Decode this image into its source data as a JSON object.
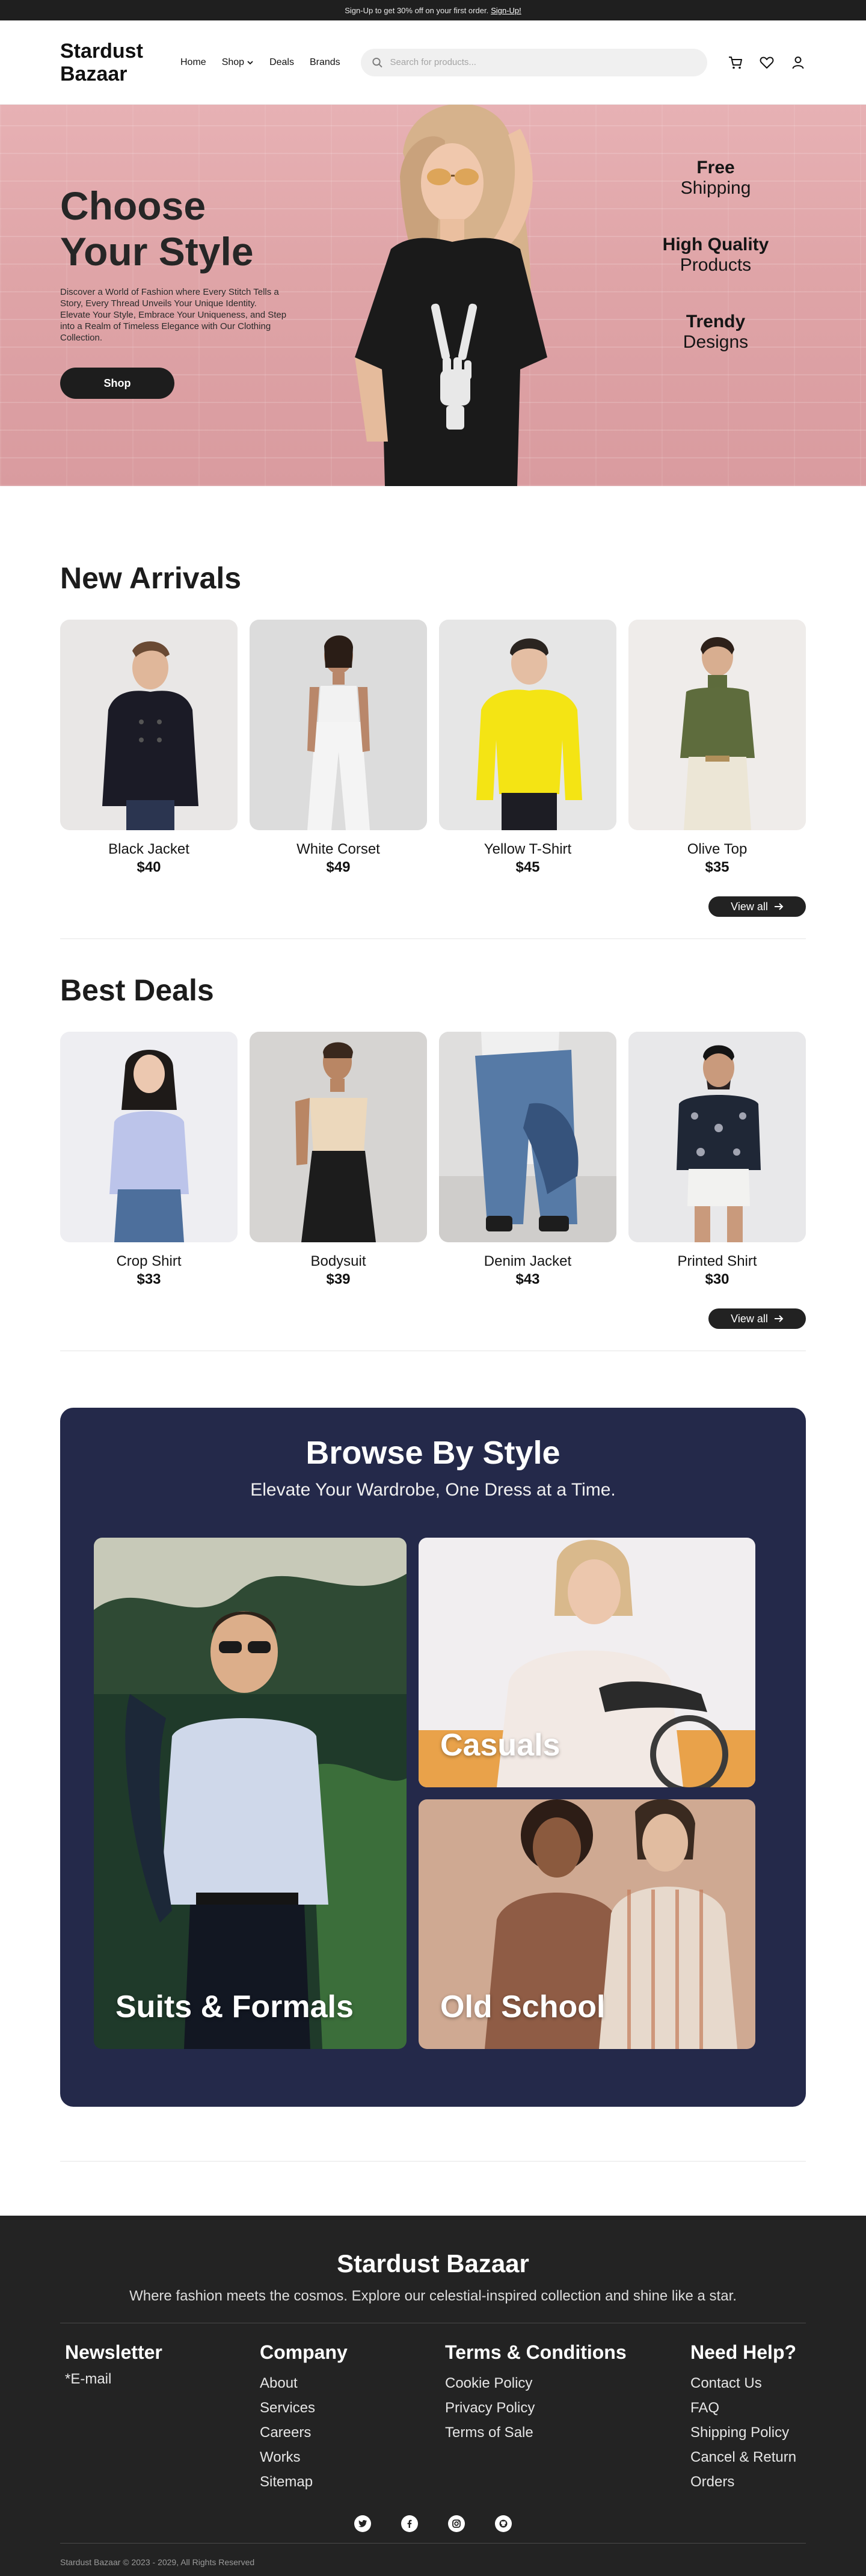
{
  "topbar": {
    "text": "Sign-Up to get 30% off on your first order.",
    "link": "Sign-Up!"
  },
  "header": {
    "logo": "Stardust Bazaar",
    "nav": [
      "Home",
      "Shop",
      "Deals",
      "Brands"
    ],
    "search_placeholder": "Search for products...",
    "icons": [
      "cart-icon",
      "heart-icon",
      "user-icon"
    ]
  },
  "hero": {
    "title": "Choose Your Style",
    "description": "Discover a World of Fashion where Every Stitch Tells a Story, Every Thread Unveils Your Unique Identity. Elevate Your Style, Embrace Your Uniqueness, and Step into a Realm of Timeless Elegance with Our Clothing Collection.",
    "button": "Shop",
    "features": [
      {
        "bold": "Free",
        "regular": "Shipping"
      },
      {
        "bold": "High Quality",
        "regular": "Products"
      },
      {
        "bold": "Trendy",
        "regular": "Designs"
      }
    ]
  },
  "new_arrivals": {
    "title": "New Arrivals",
    "items": [
      {
        "name": "Black Jacket",
        "price": "$40"
      },
      {
        "name": "White Corset",
        "price": "$49"
      },
      {
        "name": "Yellow T-Shirt",
        "price": "$45"
      },
      {
        "name": "Olive Top",
        "price": "$35"
      }
    ],
    "view_all": "View all"
  },
  "best_deals": {
    "title": "Best Deals",
    "items": [
      {
        "name": "Crop Shirt",
        "price": "$33"
      },
      {
        "name": "Bodysuit",
        "price": "$39"
      },
      {
        "name": "Denim Jacket",
        "price": "$43"
      },
      {
        "name": "Printed Shirt",
        "price": "$30"
      }
    ],
    "view_all": "View all"
  },
  "browse": {
    "title": "Browse By Style",
    "subtitle": "Elevate Your Wardrobe, One Dress at a Time.",
    "styles": [
      "Suits & Formals",
      "Casuals",
      "Old School"
    ]
  },
  "footer": {
    "brand": "Stardust Bazaar",
    "tagline": "Where fashion meets the cosmos. Explore our celestial-inspired collection and shine like a star.",
    "newsletter": {
      "title": "Newsletter",
      "email_label": "*E-mail"
    },
    "company": {
      "title": "Company",
      "links": [
        "About",
        "Services",
        "Careers",
        "Works",
        "Sitemap"
      ]
    },
    "terms": {
      "title": "Terms & Conditions",
      "links": [
        "Cookie Policy",
        "Privacy Policy",
        "Terms of Sale"
      ]
    },
    "help": {
      "title": "Need Help?",
      "links": [
        "Contact Us",
        "FAQ",
        "Shipping Policy",
        "Cancel & Return",
        "Orders"
      ]
    },
    "socials": [
      "twitter-icon",
      "facebook-icon",
      "instagram-icon",
      "github-icon"
    ],
    "copyright": "Stardust Bazaar © 2023 - 2029, All Rights Reserved"
  }
}
